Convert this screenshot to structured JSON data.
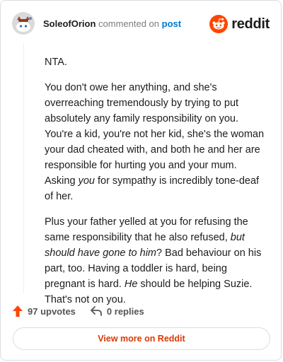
{
  "comment": {
    "author": "SoleofOrion",
    "action_text": "commented on",
    "post_link_label": "post",
    "paragraphs": [
      [
        {
          "t": "NTA."
        }
      ],
      [
        {
          "t": "You don't owe her anything, and she's overreaching tremendously by trying to put absolutely any family responsibility on you. You're a kid, you're not her kid, she's the woman your dad cheated with, and both he and her are responsible for hurting you and your mum. Asking "
        },
        {
          "t": "you",
          "em": true
        },
        {
          "t": " for sympathy is incredibly tone-deaf of her."
        }
      ],
      [
        {
          "t": "Plus your father yelled at you for refusing the same responsibility that he also refused, "
        },
        {
          "t": "but should have gone to him",
          "em": true
        },
        {
          "t": "? Bad behaviour on his part, too. Having a toddler is hard, being pregnant is hard. "
        },
        {
          "t": "He",
          "em": true
        },
        {
          "t": " should be helping Suzie. That's not on you."
        }
      ]
    ]
  },
  "brand": {
    "wordmark": "reddit",
    "icon": "reddit-snoo-icon",
    "color": "#ff4500"
  },
  "footer": {
    "upvotes_label": "97 upvotes",
    "replies_label": "0 replies",
    "upvote_icon": "upvote-arrow-icon",
    "reply_icon": "reply-arrow-icon",
    "upvote_color": "#ff4500"
  },
  "view_more_label": "View more on Reddit"
}
